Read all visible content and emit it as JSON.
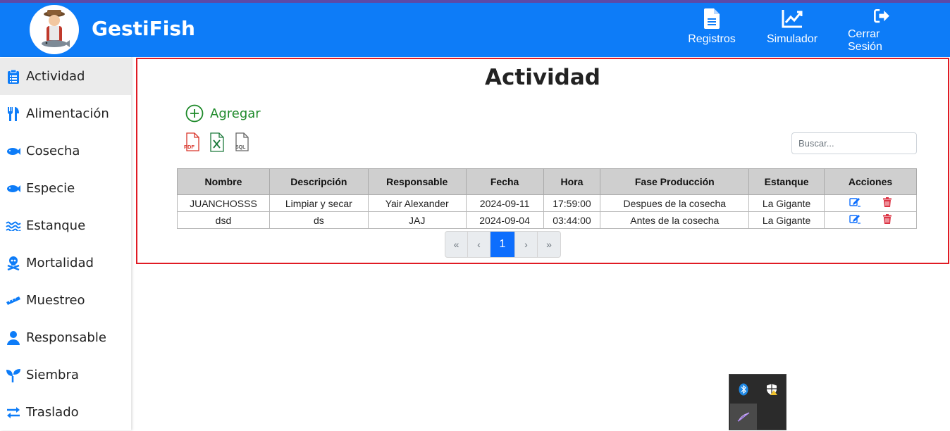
{
  "app": {
    "brand": "GestiFish"
  },
  "navbar": {
    "links": [
      {
        "label": "Registros",
        "icon": "file-lines-icon"
      },
      {
        "label": "Simulador",
        "icon": "chart-line-icon"
      },
      {
        "label": "Cerrar Sesión",
        "icon": "sign-out-icon"
      }
    ]
  },
  "sidebar": {
    "items": [
      {
        "label": "Actividad",
        "icon": "clipboard-icon",
        "active": true
      },
      {
        "label": "Alimentación",
        "icon": "utensils-icon"
      },
      {
        "label": "Cosecha",
        "icon": "fish-icon"
      },
      {
        "label": "Especie",
        "icon": "fish-icon"
      },
      {
        "label": "Estanque",
        "icon": "water-icon"
      },
      {
        "label": "Mortalidad",
        "icon": "skull-crossbones-icon"
      },
      {
        "label": "Muestreo",
        "icon": "ruler-icon"
      },
      {
        "label": "Responsable",
        "icon": "user-icon"
      },
      {
        "label": "Siembra",
        "icon": "seedling-icon"
      },
      {
        "label": "Traslado",
        "icon": "arrows-left-right-icon"
      }
    ]
  },
  "main": {
    "title": "Actividad",
    "add_label": "Agregar",
    "exports": [
      {
        "label": "PDF",
        "icon": "pdf-file-icon",
        "color": "#d9362b"
      },
      {
        "label": "",
        "icon": "excel-file-icon",
        "color": "#1d7a3c"
      },
      {
        "label": "SQL",
        "icon": "sql-file-icon",
        "color": "#555555"
      }
    ],
    "search": {
      "placeholder": "Buscar...",
      "value": ""
    },
    "table": {
      "headers": [
        "Nombre",
        "Descripción",
        "Responsable",
        "Fecha",
        "Hora",
        "Fase Producción",
        "Estanque",
        "Acciones"
      ],
      "rows": [
        [
          "JUANCHOSSS",
          "Limpiar y secar",
          "Yair Alexander",
          "2024-09-11",
          "17:59:00",
          "Despues de la cosecha",
          "La Gigante"
        ],
        [
          "dsd",
          "ds",
          "JAJ",
          "2024-09-04",
          "03:44:00",
          "Antes de la cosecha",
          "La Gigante"
        ]
      ]
    },
    "pagination": {
      "first": "«",
      "prev": "‹",
      "current": "1",
      "next": "›",
      "last": "»"
    }
  },
  "colors": {
    "navbar": "#0d7cf8",
    "accent": "#0d6efd",
    "add": "#1e8a2a",
    "delete": "#dc3545",
    "panel_border": "#e01b24"
  }
}
